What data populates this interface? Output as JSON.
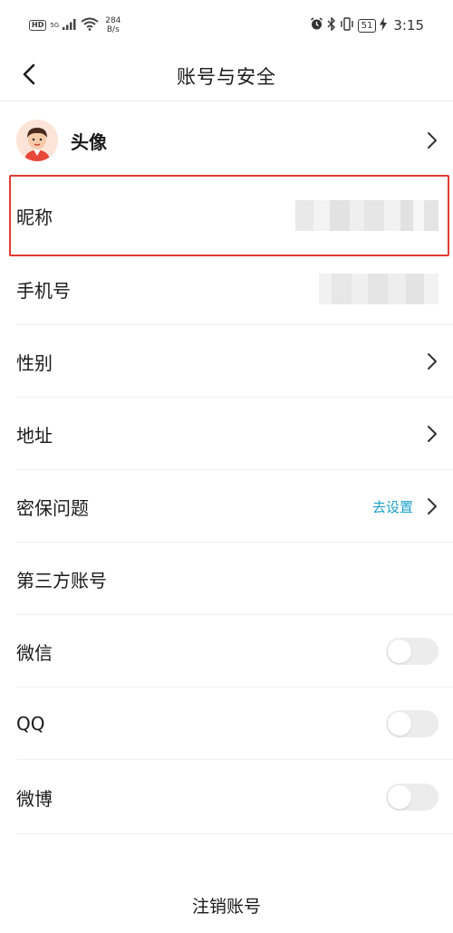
{
  "status_bar": {
    "hd": "HD",
    "signal_tech": "5G",
    "net_speed_value": "284",
    "net_speed_unit": "B/s",
    "battery": "51",
    "time": "3:15",
    "icons": [
      "alarm-icon",
      "bluetooth-icon",
      "vibrate-icon",
      "battery-icon",
      "charging-icon"
    ]
  },
  "header": {
    "title": "账号与安全",
    "back_icon": "chevron-left-icon"
  },
  "rows": {
    "avatar": {
      "label": "头像"
    },
    "nickname": {
      "label": "昵称"
    },
    "phone": {
      "label": "手机号"
    },
    "gender": {
      "label": "性别"
    },
    "address": {
      "label": "地址"
    },
    "security_question": {
      "label": "密保问题",
      "action": "去设置"
    },
    "third_party": {
      "label": "第三方账号"
    },
    "wechat": {
      "label": "微信",
      "enabled": false
    },
    "qq": {
      "label": "QQ",
      "enabled": false
    },
    "weibo": {
      "label": "微博",
      "enabled": false
    }
  },
  "footer": {
    "cancel_account": "注销账号"
  },
  "colors": {
    "accent_link": "#1aa1c9",
    "highlight_border": "#e23b32",
    "toggle_off": "#ececec"
  }
}
